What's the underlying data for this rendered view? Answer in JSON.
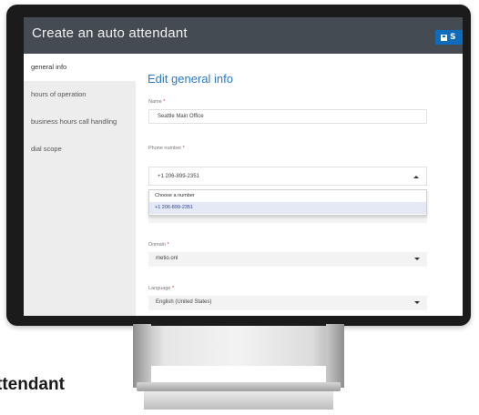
{
  "app": {
    "title": "Create an auto attendant",
    "save_label": "S"
  },
  "sidebar": {
    "items": [
      {
        "label": "general info"
      },
      {
        "label": "hours of operation"
      },
      {
        "label": "business hours call handling"
      },
      {
        "label": "dial scope"
      }
    ]
  },
  "form": {
    "heading": "Edit general info",
    "name": {
      "label": "Name",
      "required": "*",
      "value": "Seattle Main Office"
    },
    "phone": {
      "label": "Phone number",
      "required": "*",
      "value": "+1 206-899-2351"
    },
    "phone_options": {
      "header": "Choose a number",
      "items": [
        "+1 206-899-2351"
      ]
    },
    "domain": {
      "label": "Domain",
      "required": "*",
      "value": "metio.onl"
    },
    "language": {
      "label": "Language",
      "required": "*",
      "value": "English (United States)"
    }
  },
  "caption": "ttendant"
}
